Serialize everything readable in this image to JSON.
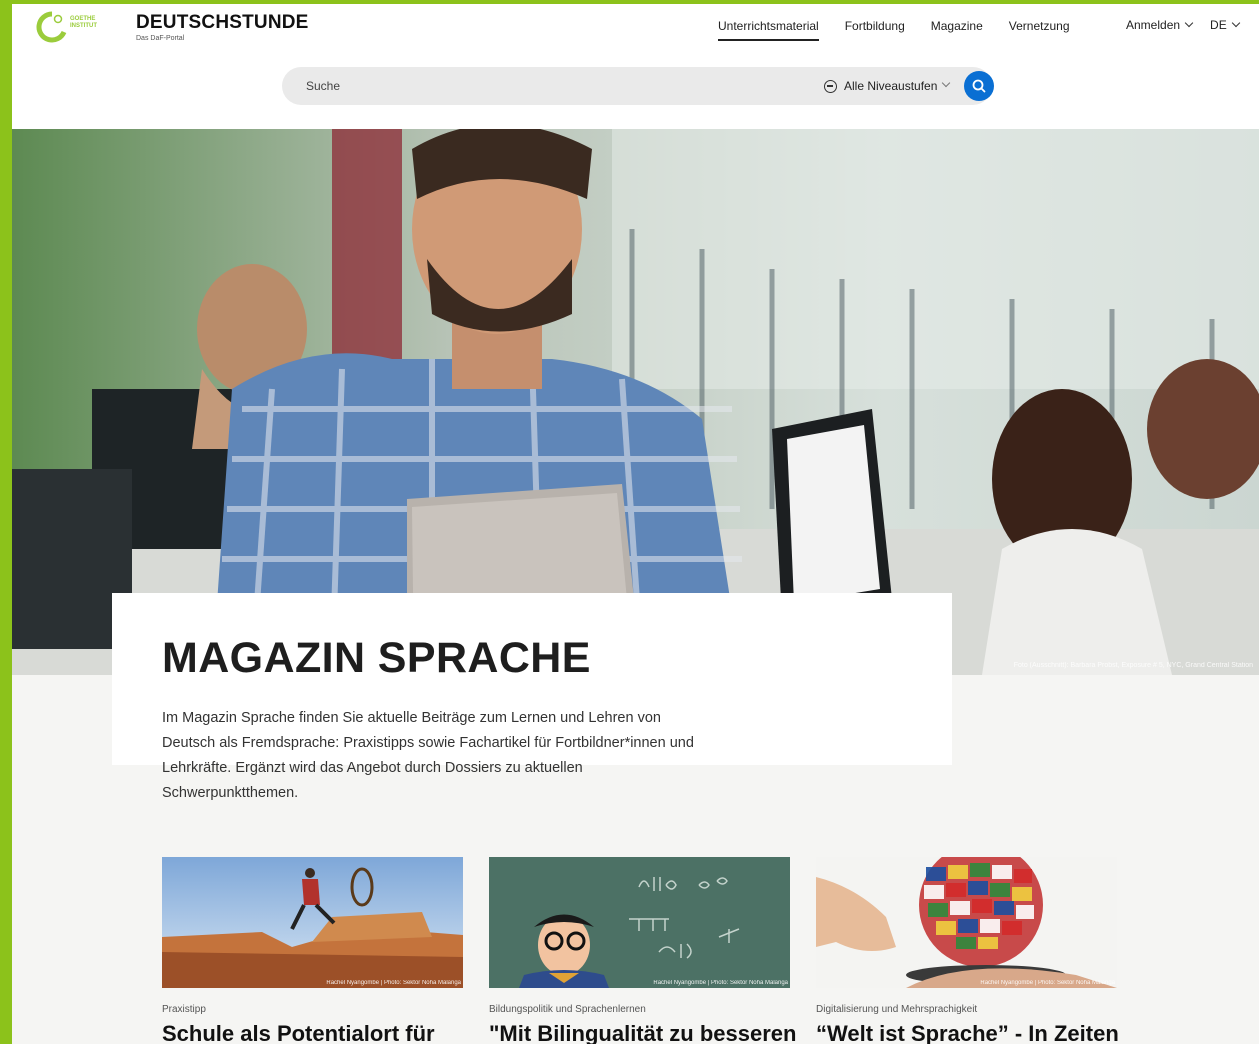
{
  "header": {
    "logo_lines": [
      "GOETHE",
      "INSTITUT"
    ],
    "brand_title": "DEUTSCHSTUNDE",
    "brand_subtitle": "Das DaF-Portal",
    "nav": [
      {
        "label": "Unterrichtsmaterial",
        "active": true
      },
      {
        "label": "Fortbildung",
        "active": false
      },
      {
        "label": "Magazine",
        "active": false
      },
      {
        "label": "Vernetzung",
        "active": false
      }
    ],
    "login_label": "Anmelden",
    "language_label": "DE"
  },
  "search": {
    "placeholder": "Suche",
    "level_label": "Alle Niveaustufen",
    "accent_color": "#0a6fd3"
  },
  "hero": {
    "photo_credit": "Foto (Ausschnitt): Barbara Probst, Exposure # 5, NYC, Grand Central Station"
  },
  "intro": {
    "title": "MAGAZIN SPRACHE",
    "text": "Im Magazin Sprache finden Sie aktuelle Beiträge zum Lernen und Lehren von Deutsch als Fremdsprache: Praxistipps sowie Fachartikel für Fortbildner*innen und Lehrkräfte. Ergänzt wird das Angebot durch Dossiers zu aktuellen Schwerpunktthemen."
  },
  "cards": [
    {
      "category": "Praxistipp",
      "title": "Schule als Potentialort für",
      "caption": "Rachel Nyangombe | Photo: Sektor Noha Malanga"
    },
    {
      "category": "Bildungspolitik und Sprachenlernen",
      "title": "\"Mit Bilingualität zu besseren",
      "caption": "Rachel Nyangombe | Photo: Sektor Noha Malanga"
    },
    {
      "category": "Digitalisierung und Mehrsprachigkeit",
      "title": "“Welt ist Sprache” -  In Zeiten",
      "caption": "Rachel Nyangombe | Photo: Sektor Noha Malanga"
    }
  ]
}
